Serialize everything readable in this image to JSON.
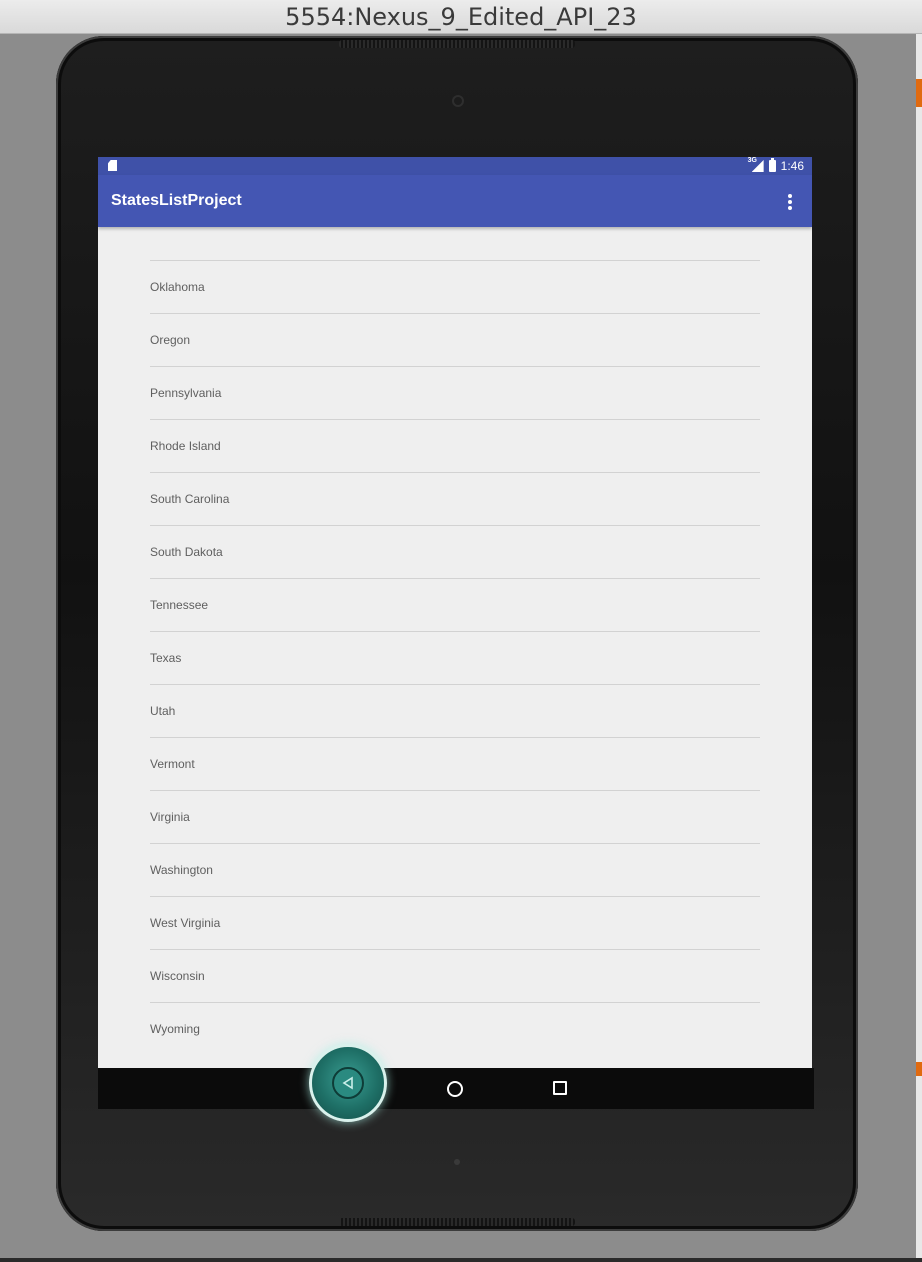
{
  "window": {
    "title": "5554:Nexus_9_Edited_API_23"
  },
  "status_bar": {
    "network_tag": "3G",
    "time": "1:46"
  },
  "app_bar": {
    "title": "StatesListProject"
  },
  "states": [
    "Oklahoma",
    "Oregon",
    "Pennsylvania",
    "Rhode Island",
    "South Carolina",
    "South Dakota",
    "Tennessee",
    "Texas",
    "Utah",
    "Vermont",
    "Virginia",
    "Washington",
    "West Virginia",
    "Wisconsin",
    "Wyoming"
  ],
  "colors": {
    "primary": "#4456b3",
    "primary_dark": "#3f51a8",
    "list_background": "#efefef",
    "back_overlay": "#2a8a80",
    "console_text": "#c0392b",
    "orange_marker": "#e06a10"
  },
  "icons": {
    "status_left": "sd-card-icon",
    "status_signal": "cell-signal-icon",
    "status_battery": "battery-icon",
    "menu": "overflow-menu-icon",
    "nav_back": "back-icon",
    "nav_home": "home-icon",
    "nav_recents": "recents-icon"
  }
}
